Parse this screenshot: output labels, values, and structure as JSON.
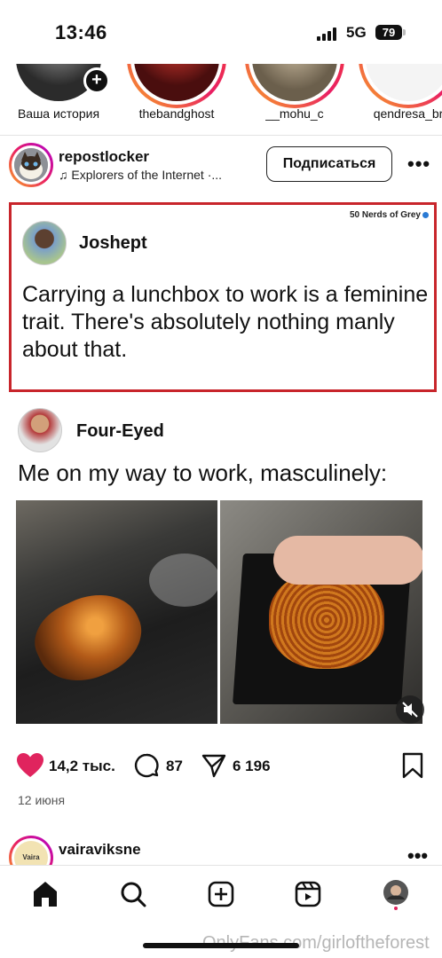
{
  "status_bar": {
    "time": "13:46",
    "network": "5G",
    "battery": "79"
  },
  "stories": [
    {
      "label": "Ваша история"
    },
    {
      "label": "thebandghost"
    },
    {
      "label": "__mohu_c"
    },
    {
      "label": "qendresa_br"
    }
  ],
  "post": {
    "username": "repostlocker",
    "music": "Explorers of the Internet ·...",
    "follow_label": "Подписаться",
    "media": {
      "tweet": {
        "source": "50 Nerds of Grey",
        "author": "Joshept",
        "text": "Carrying a lunchbox to work is a feminine trait. There's absolutely nothing manly about that."
      },
      "reply": {
        "author": "Four-Eyed",
        "text": "Me on my way to work, masculinely:"
      }
    },
    "likes": "14,2 тыс.",
    "comments": "87",
    "shares": "6 196",
    "date": "12 июня"
  },
  "next_post": {
    "username": "vairaviksne",
    "avatar_text": "Vaira Viksne"
  },
  "watermark": "OnlyFans.com/girloftheforest",
  "colors": {
    "like": "#e0245e",
    "highlight_border": "#c8252b",
    "story_ring": "#e91e63"
  },
  "tab_bar": [
    {
      "icon": "home-icon"
    },
    {
      "icon": "search-icon"
    },
    {
      "icon": "create-icon"
    },
    {
      "icon": "reels-icon"
    },
    {
      "icon": "profile-icon"
    }
  ]
}
